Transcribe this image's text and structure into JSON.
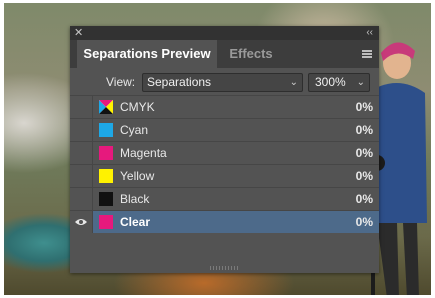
{
  "panel": {
    "tabs": [
      {
        "label": "Separations Preview",
        "active": true
      },
      {
        "label": "Effects",
        "active": false
      }
    ],
    "view_label": "View:",
    "view_value": "Separations",
    "zoom_value": "300%"
  },
  "separations": [
    {
      "name": "CMYK",
      "percent": "0%",
      "swatch": "cmyk",
      "visible": false,
      "selected": false
    },
    {
      "name": "Cyan",
      "percent": "0%",
      "swatch": "#1ea8e6",
      "visible": false,
      "selected": false
    },
    {
      "name": "Magenta",
      "percent": "0%",
      "swatch": "#e6197d",
      "visible": false,
      "selected": false
    },
    {
      "name": "Yellow",
      "percent": "0%",
      "swatch": "#fff200",
      "visible": false,
      "selected": false
    },
    {
      "name": "Black",
      "percent": "0%",
      "swatch": "#111111",
      "visible": false,
      "selected": false
    },
    {
      "name": "Clear",
      "percent": "0%",
      "swatch": "#e6197d",
      "visible": true,
      "selected": true
    }
  ],
  "colors": {
    "panel_bg": "#535353",
    "selected_row": "#4d6a8a",
    "accent_magenta": "#e6197d"
  }
}
